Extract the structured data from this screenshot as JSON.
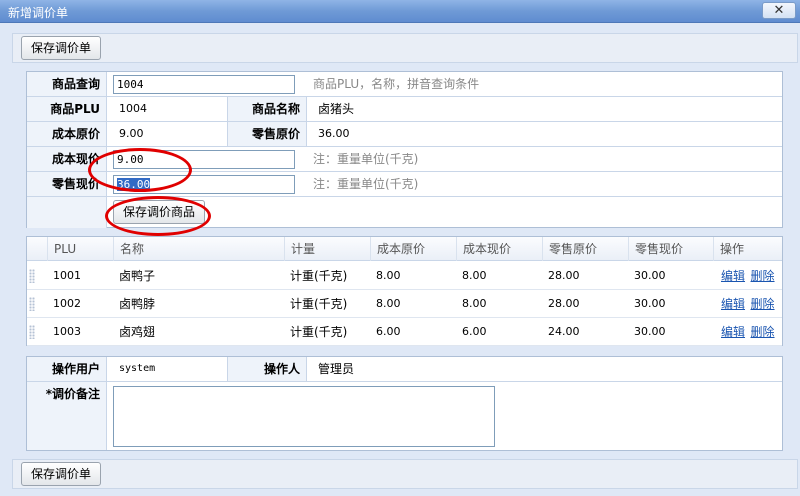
{
  "window": {
    "title": "新增调价单",
    "close_glyph": "✕"
  },
  "toolbar": {
    "save_label": "保存调价单"
  },
  "query": {
    "label": "商品查询",
    "value": "1004",
    "hint": "商品PLU，名称，拼音查询条件"
  },
  "product": {
    "plu_label": "商品PLU",
    "plu_value": "1004",
    "name_label": "商品名称",
    "name_value": "卤猪头",
    "cost_orig_label": "成本原价",
    "cost_orig_value": "9.00",
    "retail_orig_label": "零售原价",
    "retail_orig_value": "36.00"
  },
  "edit": {
    "cost_now_label": "成本现价",
    "cost_now_value": "9.00",
    "cost_now_hint": "注：重量单位(千克)",
    "retail_now_label": "零售现价",
    "retail_now_value": "36.00",
    "retail_now_hint": "注：重量单位(千克)",
    "save_item_label": "保存调价商品"
  },
  "grid": {
    "columns": [
      "PLU",
      "名称",
      "计量",
      "成本原价",
      "成本现价",
      "零售原价",
      "零售现价",
      "操作"
    ],
    "rows": [
      {
        "plu": "1001",
        "name": "卤鸭子",
        "unit": "计重(千克)",
        "cost_orig": "8.00",
        "cost_now": "8.00",
        "retail_orig": "28.00",
        "retail_now": "30.00",
        "edit": "编辑",
        "del": "删除"
      },
      {
        "plu": "1002",
        "name": "卤鸭脖",
        "unit": "计重(千克)",
        "cost_orig": "8.00",
        "cost_now": "8.00",
        "retail_orig": "28.00",
        "retail_now": "30.00",
        "edit": "编辑",
        "del": "删除"
      },
      {
        "plu": "1003",
        "name": "卤鸡翅",
        "unit": "计重(千克)",
        "cost_orig": "6.00",
        "cost_now": "6.00",
        "retail_orig": "24.00",
        "retail_now": "30.00",
        "edit": "编辑",
        "del": "删除"
      }
    ]
  },
  "footer": {
    "user_label": "操作用户",
    "user_value": "system",
    "operator_label": "操作人",
    "operator_value": "管理员",
    "note_label": "*调价备注"
  },
  "colors": {
    "annotation": "#e00000",
    "header_bg": "#6f9ad6",
    "frame_bg": "#dfe8f6"
  }
}
